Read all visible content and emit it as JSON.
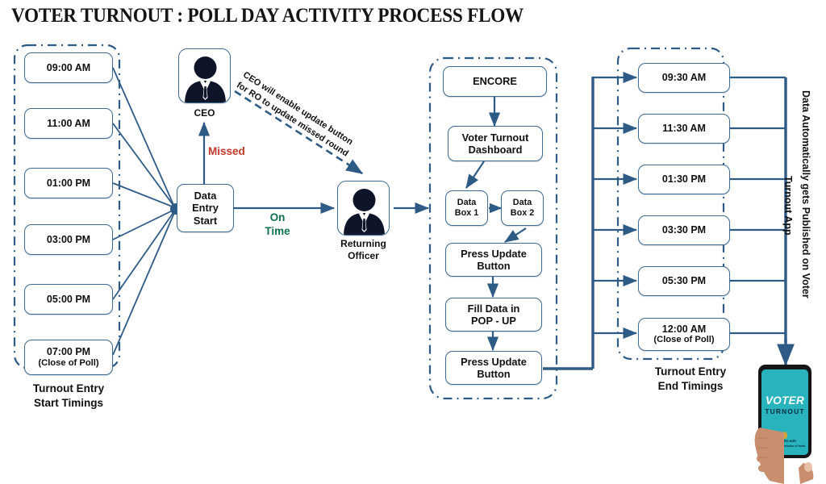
{
  "title": "VOTER TURNOUT : POLL DAY ACTIVITY PROCESS FLOW",
  "start_timings": {
    "group_label_line1": "Turnout Entry",
    "group_label_line2": "Start Timings",
    "items": [
      {
        "time": "09:00 AM",
        "note": ""
      },
      {
        "time": "11:00 AM",
        "note": ""
      },
      {
        "time": "01:00 PM",
        "note": ""
      },
      {
        "time": "03:00 PM",
        "note": ""
      },
      {
        "time": "05:00 PM",
        "note": ""
      },
      {
        "time": "07:00 PM",
        "note": "(Close of Poll)"
      }
    ]
  },
  "end_timings": {
    "group_label_line1": "Turnout Entry",
    "group_label_line2": "End Timings",
    "items": [
      {
        "time": "09:30 AM",
        "note": ""
      },
      {
        "time": "11:30 AM",
        "note": ""
      },
      {
        "time": "01:30 PM",
        "note": ""
      },
      {
        "time": "03:30 PM",
        "note": ""
      },
      {
        "time": "05:30 PM",
        "note": ""
      },
      {
        "time": "12:00 AM",
        "note": "(Close of Poll)"
      }
    ]
  },
  "nodes": {
    "data_entry_start_l1": "Data",
    "data_entry_start_l2": "Entry",
    "data_entry_start_l3": "Start",
    "ceo_caption": "CEO",
    "ro_caption_l1": "Returning",
    "ro_caption_l2": "Officer",
    "encore": "ENCORE",
    "dashboard_l1": "Voter Turnout",
    "dashboard_l2": "Dashboard",
    "data_box_1_l1": "Data",
    "data_box_1_l2": "Box 1",
    "data_box_2_l1": "Data",
    "data_box_2_l2": "Box 2",
    "press_update_1_l1": "Press Update",
    "press_update_1_l2": "Button",
    "fill_popup_l1": "Fill Data in",
    "fill_popup_l2": "POP - UP",
    "press_update_2_l1": "Press Update",
    "press_update_2_l2": "Button"
  },
  "edge_labels": {
    "missed": "Missed",
    "on_time_l1": "On",
    "on_time_l2": "Time",
    "ceo_note_l1": "CEO will enable update button",
    "ceo_note_l2": "for RO to update missed round"
  },
  "side_text": {
    "line1": "Data Automatically gets Published on Voter",
    "line2": "Turnout App"
  },
  "phone": {
    "app_name_primary": "VOTER",
    "app_name_secondary": "TURNOUT",
    "footer_l1": "भारत निर्वाचन आयोग",
    "footer_l2": "Election Commission of India"
  },
  "colors": {
    "line": "#2E5A86",
    "node_border": "#3f6b92",
    "missed": "#C0392B",
    "on_time": "#12714C",
    "phone_screen": "#28b3bd"
  }
}
